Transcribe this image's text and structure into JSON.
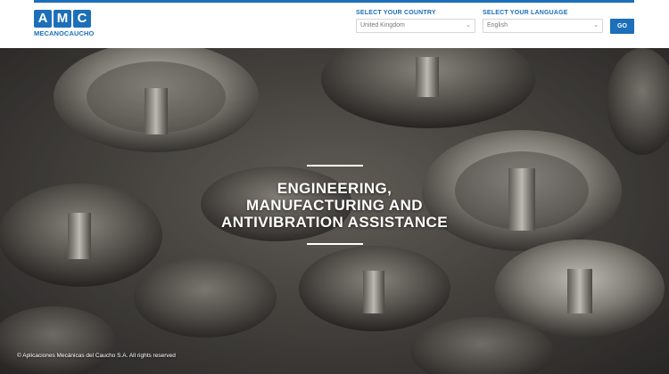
{
  "header": {
    "logo": {
      "letters": [
        "A",
        "M",
        "C"
      ],
      "subtitle": "MECANOCAUCHO"
    },
    "country": {
      "label": "SELECT YOUR COUNTRY",
      "selected": "United Kingdom"
    },
    "language": {
      "label": "SELECT YOUR LANGUAGE",
      "selected": "English"
    },
    "go_label": "GO"
  },
  "hero": {
    "title_lines": [
      "ENGINEERING,",
      "MANUFACTURING AND",
      "ANTIVIBRATION ASSISTANCE"
    ]
  },
  "footer": {
    "copyright": "© Aplicaciones Mecánicas del Caucho S.A. All rights reserved"
  },
  "colors": {
    "brand_blue": "#1c6fb8",
    "hero_text": "#ffffff"
  }
}
